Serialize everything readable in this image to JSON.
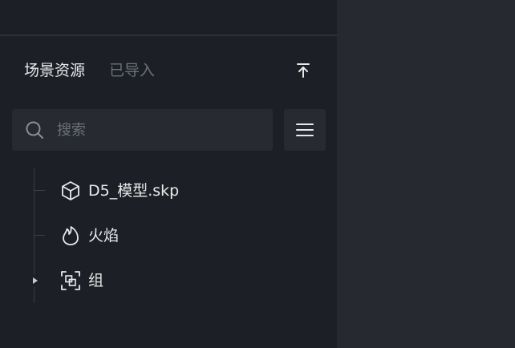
{
  "panel": {
    "tabs": [
      {
        "label": "场景资源",
        "active": true
      },
      {
        "label": "已导入",
        "active": false
      }
    ],
    "collapse_icon": "collapse-to-top-icon",
    "search": {
      "placeholder": "搜索",
      "value": "",
      "icon": "search-icon"
    },
    "menu_icon": "hamburger-menu-icon",
    "tree": [
      {
        "label": "D5_模型.skp",
        "icon": "cube-icon",
        "expandable": false
      },
      {
        "label": "火焰",
        "icon": "flame-icon",
        "expandable": false
      },
      {
        "label": "组",
        "icon": "group-icon",
        "expandable": true,
        "expanded": false
      }
    ]
  },
  "colors": {
    "panel_bg": "#1c1f25",
    "right_bg": "#262930",
    "input_bg": "#272a31",
    "text_primary": "#e8e9eb",
    "text_muted": "#6c7079"
  }
}
